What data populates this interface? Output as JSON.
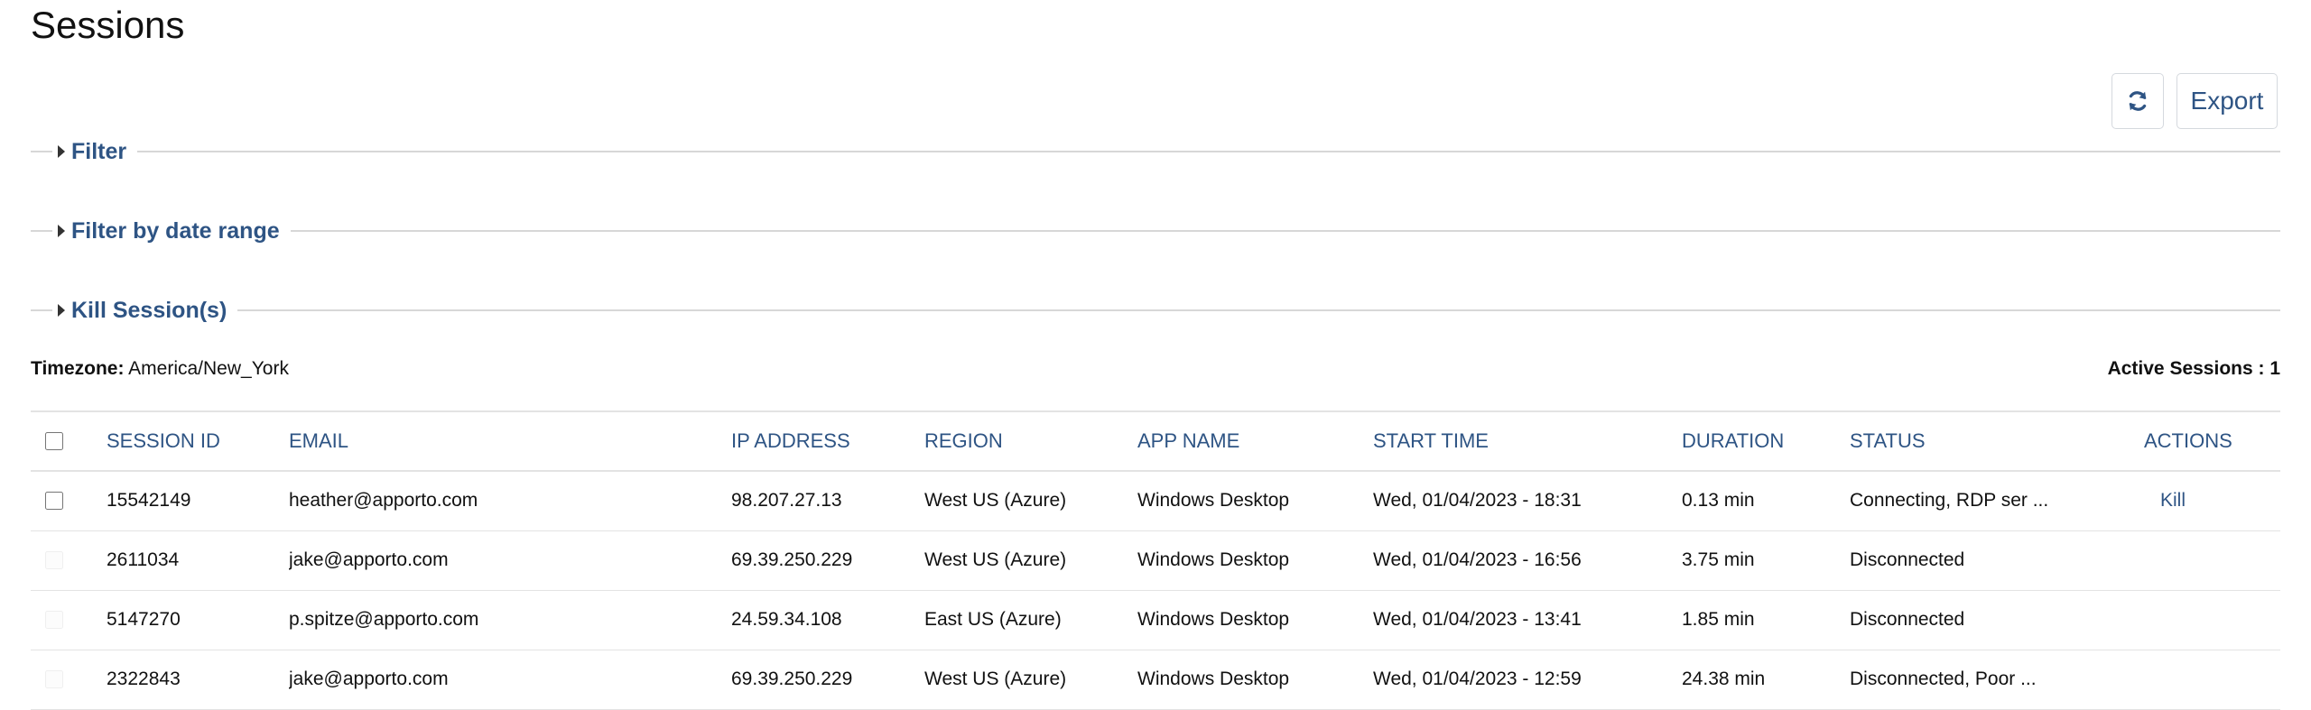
{
  "page": {
    "title": "Sessions"
  },
  "toolbar": {
    "refresh_icon": "refresh-icon",
    "export_label": "Export"
  },
  "sections": [
    {
      "label": "Filter"
    },
    {
      "label": "Filter by date range"
    },
    {
      "label": "Kill Session(s)"
    }
  ],
  "info": {
    "timezone_label": "Timezone:",
    "timezone_value": "America/New_York",
    "active_sessions": "Active Sessions : 1"
  },
  "table": {
    "headers": [
      "SESSION ID",
      "EMAIL",
      "IP ADDRESS",
      "REGION",
      "APP NAME",
      "START TIME",
      "DURATION",
      "STATUS",
      "ACTIONS"
    ],
    "rows": [
      {
        "session_id": "15542149",
        "email": "heather@apporto.com",
        "ip": "98.207.27.13",
        "region": "West US (Azure)",
        "app": "Windows Desktop",
        "start": "Wed, 01/04/2023 - 18:31",
        "duration": "0.13 min",
        "status": "Connecting, RDP ser ...",
        "action": "Kill",
        "selectable": true
      },
      {
        "session_id": "2611034",
        "email": "jake@apporto.com",
        "ip": "69.39.250.229",
        "region": "West US (Azure)",
        "app": "Windows Desktop",
        "start": "Wed, 01/04/2023 - 16:56",
        "duration": "3.75 min",
        "status": "Disconnected",
        "action": "",
        "selectable": false
      },
      {
        "session_id": "5147270",
        "email": "p.spitze@apporto.com",
        "ip": "24.59.34.108",
        "region": "East US (Azure)",
        "app": "Windows Desktop",
        "start": "Wed, 01/04/2023 - 13:41",
        "duration": "1.85 min",
        "status": "Disconnected",
        "action": "",
        "selectable": false
      },
      {
        "session_id": "2322843",
        "email": "jake@apporto.com",
        "ip": "69.39.250.229",
        "region": "West US (Azure)",
        "app": "Windows Desktop",
        "start": "Wed, 01/04/2023 - 12:59",
        "duration": "24.38 min",
        "status": "Disconnected, Poor ...",
        "action": "",
        "selectable": false
      }
    ]
  }
}
